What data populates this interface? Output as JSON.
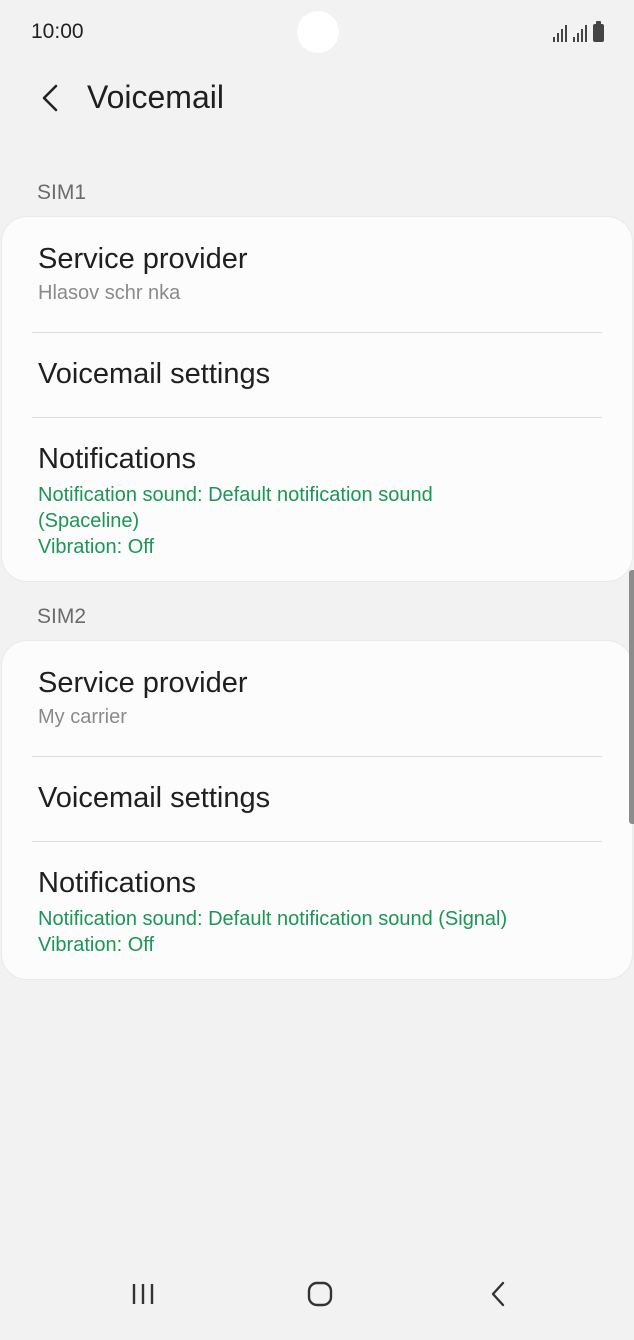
{
  "status_bar": {
    "time": "10:00",
    "icons": [
      "signal-icon",
      "signal-icon",
      "battery-icon"
    ]
  },
  "header": {
    "back_icon": "chevron-left-icon",
    "title": "Voicemail"
  },
  "sections": [
    {
      "header": "SIM1",
      "items": [
        {
          "title": "Service provider",
          "subtitle": "Hlasov  schr nka"
        },
        {
          "title": "Voicemail settings"
        },
        {
          "title": "Notifications",
          "detail_line1": "Notification sound: Default notification sound",
          "detail_line2": "(Spaceline)",
          "detail_line3": "Vibration: Off"
        }
      ]
    },
    {
      "header": "SIM2",
      "items": [
        {
          "title": "Service provider",
          "subtitle": "My carrier"
        },
        {
          "title": "Voicemail settings"
        },
        {
          "title": "Notifications",
          "detail_line1": "Notification sound: Default notification sound (Signal)",
          "detail_line2": "Vibration: Off"
        }
      ]
    }
  ],
  "nav_bar": {
    "icons": [
      "recent-apps-icon",
      "home-icon",
      "back-icon"
    ]
  },
  "colors": {
    "background": "#f2f2f2",
    "card": "#fcfcfc",
    "accent_green": "#1a9656",
    "secondary_text": "#8a8a8a"
  }
}
